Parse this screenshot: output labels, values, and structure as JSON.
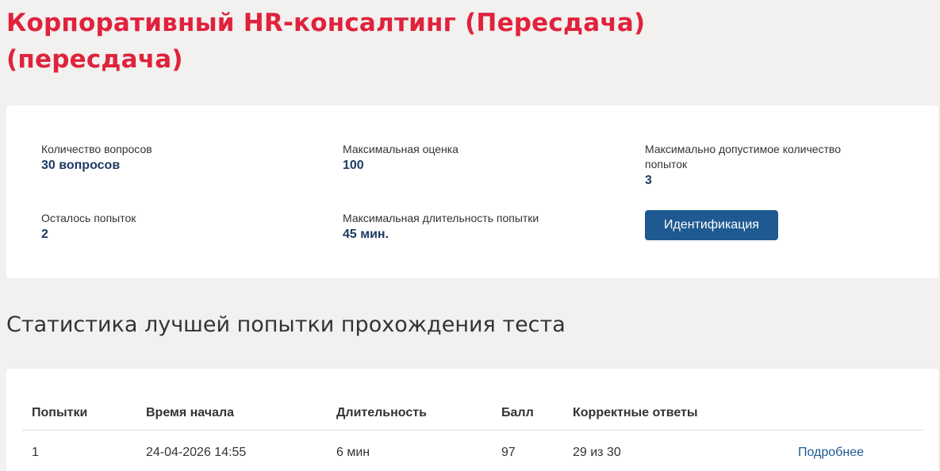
{
  "page": {
    "title": "Корпоративный HR-консалтинг (Пересдача) (пересдача)"
  },
  "info": {
    "questions_label": "Количество вопросов",
    "questions_value": "30 вопросов",
    "max_score_label": "Максимальная оценка",
    "max_score_value": "100",
    "max_attempts_label": "Максимально допустимое количество попыток",
    "max_attempts_value": "3",
    "remaining_label": "Осталось попыток",
    "remaining_value": "2",
    "max_duration_label": "Максимальная длительность попытки",
    "max_duration_value": "45 мин.",
    "identify_button": "Идентификация"
  },
  "stats": {
    "section_title": "Статистика лучшей попытки прохождения теста",
    "headers": [
      "Попытки",
      "Время начала",
      "Длительность",
      "Балл",
      "Корректные ответы"
    ],
    "rows": [
      {
        "attempt": "1",
        "start_time": "24-04-2026 14:55",
        "duration": "6 мин",
        "score": "97",
        "correct": "29 из 30",
        "details_link": "Подробнее"
      }
    ]
  }
}
